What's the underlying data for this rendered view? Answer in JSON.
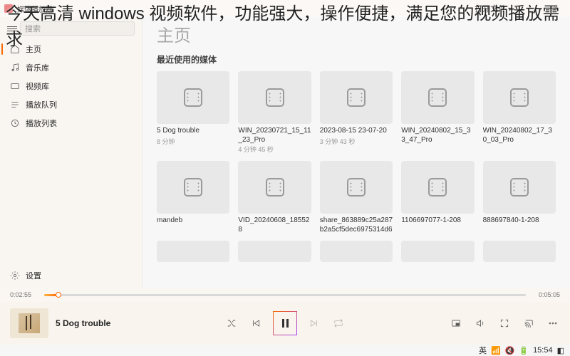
{
  "overlay": "今天高清 windows 视频软件，功能强大，操作便捷，满足您的视频播放需求",
  "titlebar": {
    "title": "媒体播放器",
    "open_file": "打开文件",
    "minimize": "—",
    "close": "×"
  },
  "search": {
    "placeholder": "搜索"
  },
  "sidebar": {
    "items": [
      {
        "icon": "home-icon",
        "label": "主页",
        "active": true
      },
      {
        "icon": "music-icon",
        "label": "音乐库"
      },
      {
        "icon": "video-icon",
        "label": "视频库"
      },
      {
        "icon": "queue-icon",
        "label": "播放队列"
      },
      {
        "icon": "playlist-icon",
        "label": "播放列表"
      }
    ],
    "settings": "设置"
  },
  "content": {
    "page_title": "主页",
    "section_title": "最近使用的媒体",
    "media": [
      {
        "title": "5 Dog trouble",
        "duration": "8 分钟"
      },
      {
        "title": "WIN_20230721_15_11_23_Pro",
        "duration": "4 分钟 45 秒"
      },
      {
        "title": "2023-08-15 23-07-20",
        "duration": "3 分钟 43 秒"
      },
      {
        "title": "WIN_20240802_15_33_47_Pro",
        "duration": ""
      },
      {
        "title": "WIN_20240802_17_30_03_Pro",
        "duration": ""
      },
      {
        "title": "mandeb",
        "duration": ""
      },
      {
        "title": "VID_20240608_185528",
        "duration": ""
      },
      {
        "title": "share_863889c25a287b2a5cf5dec6975314d6",
        "duration": ""
      },
      {
        "title": "1106697077-1-208",
        "duration": ""
      },
      {
        "title": "888697840-1-208",
        "duration": ""
      }
    ]
  },
  "player": {
    "elapsed": "0:02:55",
    "total": "0:05:05",
    "now_playing": "5 Dog trouble"
  },
  "taskbar": {
    "ime": "英",
    "time": "15:54"
  }
}
